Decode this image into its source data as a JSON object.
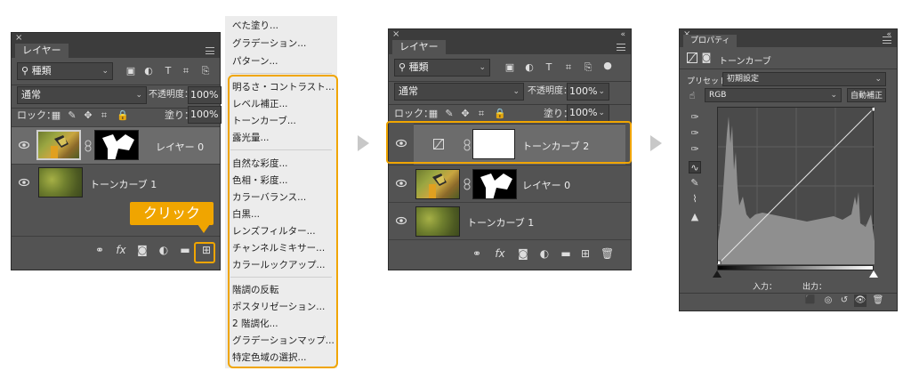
{
  "panel1": {
    "tab_label": "レイヤー",
    "filter_value": "種類",
    "blend_mode": "通常",
    "opacity_label": "不透明度：",
    "opacity_value": "100%",
    "lock_label": "ロック：",
    "fill_label": "塗り：",
    "fill_value": "100%",
    "layers": [
      {
        "name": "レイヤー 0"
      },
      {
        "name": "トーンカーブ 1"
      }
    ],
    "callout_label": "クリック"
  },
  "adjustment_menu": {
    "groups": [
      [
        "べた塗り...",
        "グラデーション...",
        "パターン..."
      ],
      [
        "明るさ・コントラスト...",
        "レベル補正...",
        "トーンカーブ...",
        "露光量..."
      ],
      [
        "自然な彩度...",
        "色相・彩度...",
        "カラーバランス...",
        "白黒...",
        "レンズフィルター...",
        "チャンネルミキサー...",
        "カラールックアップ..."
      ],
      [
        "階調の反転",
        "ポスタリゼーション...",
        "2 階調化...",
        "グラデーションマップ...",
        "特定色域の選択..."
      ]
    ]
  },
  "panel2": {
    "tab_label": "レイヤー",
    "filter_value": "種類",
    "blend_mode": "通常",
    "opacity_label": "不透明度：",
    "opacity_value": "100%",
    "lock_label": "ロック：",
    "fill_label": "塗り：",
    "fill_value": "100%",
    "layers": [
      {
        "name": "トーンカーブ 2"
      },
      {
        "name": "レイヤー 0"
      },
      {
        "name": "トーンカーブ 1"
      }
    ]
  },
  "panel3": {
    "tab_label": "プロパティ",
    "header_title": "トーンカーブ",
    "preset_label": "プリセット：",
    "preset_value": "初期設定",
    "channel_value": "RGB",
    "auto_button": "自動補正",
    "input_label": "入力：",
    "output_label": "出力："
  },
  "colors": {
    "accent": "#f0a500",
    "panel_bg": "#535353",
    "titlebar": "#3c3c3c",
    "menu_bg": "#ececec"
  }
}
